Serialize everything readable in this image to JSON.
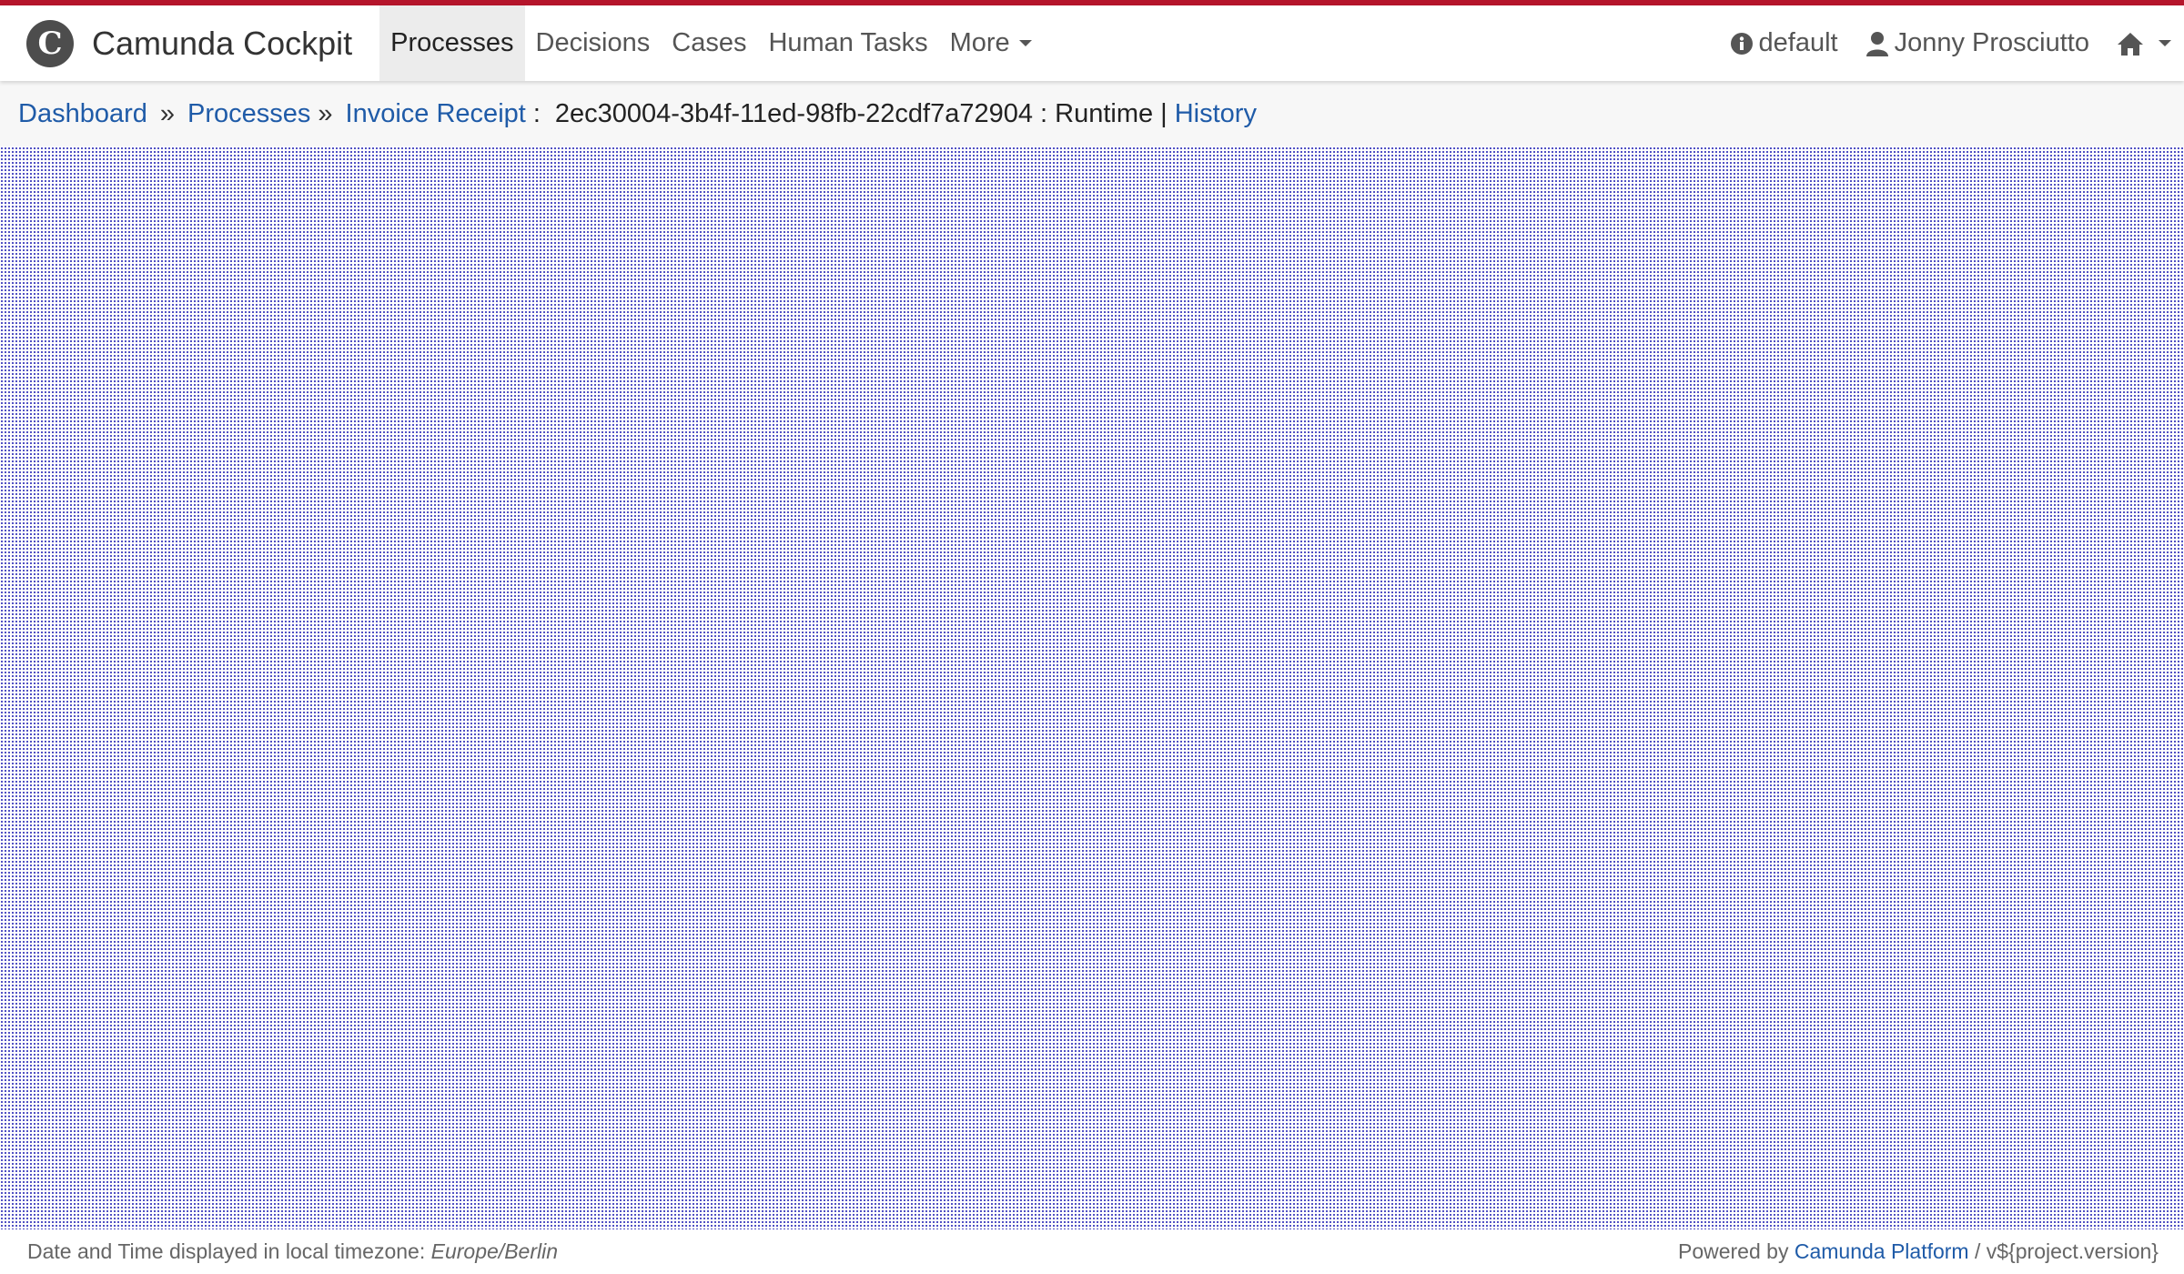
{
  "brand": {
    "logo_glyph": "C",
    "name": "Camunda Cockpit"
  },
  "nav": {
    "items": [
      {
        "label": "Processes"
      },
      {
        "label": "Decisions"
      },
      {
        "label": "Cases"
      },
      {
        "label": "Human Tasks"
      },
      {
        "label": "More"
      }
    ]
  },
  "header_right": {
    "engine": "default",
    "user": "Jonny Prosciutto"
  },
  "breadcrumb": {
    "dashboard": "Dashboard",
    "sep1": "»",
    "processes": "Processes",
    "sep2": "»",
    "process": "Invoice Receipt",
    "colon": ":",
    "instance_id": "2ec30004-3b4f-11ed-98fb-22cdf7a72904",
    "runtime": ": Runtime |",
    "history": "History"
  },
  "footer": {
    "timezone_label": "Date and Time displayed in local timezone:",
    "timezone_value": "Europe/Berlin",
    "powered_by": "Powered by",
    "platform_link": "Camunda Platform",
    "version": "/ v${project.version}"
  },
  "colors": {
    "accent_bar": "#b5152b",
    "link": "#1f5ba8",
    "canvas_dots": "#2f2fb8"
  }
}
